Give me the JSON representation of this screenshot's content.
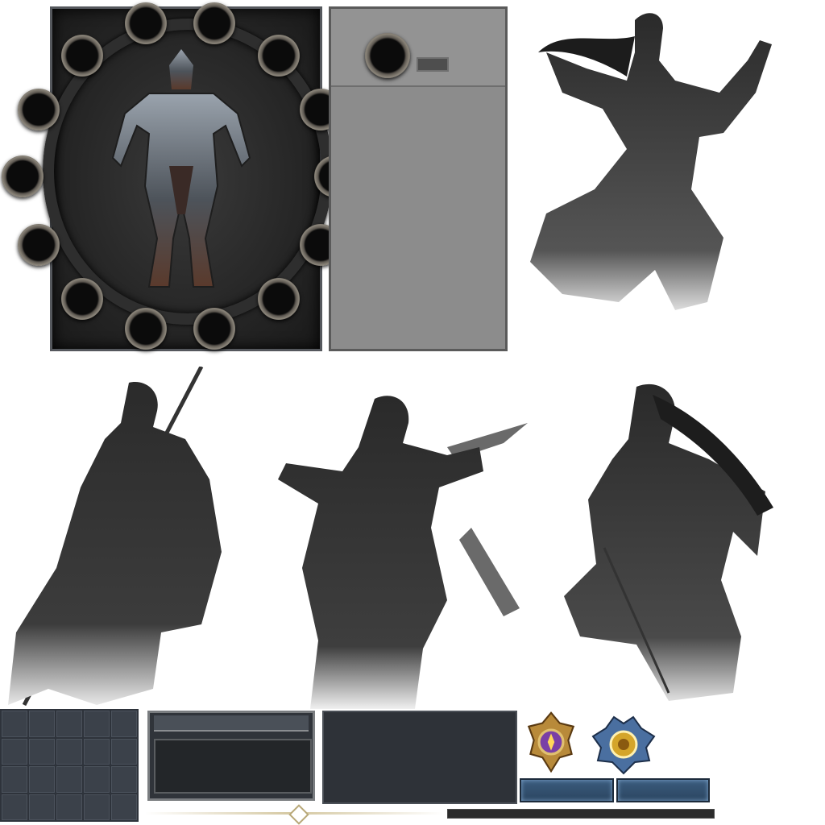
{
  "equipment": {
    "slot_count": 14,
    "slot_icon": "empty-gear-slot-icon",
    "figure_icon": "armored-knight-silhouette-icon"
  },
  "detail_panel": {
    "slot_icon": "empty-gear-slot-icon"
  },
  "characters": [
    {
      "icon": "female-swordswoman-portrait"
    },
    {
      "icon": "male-spearman-portrait"
    },
    {
      "icon": "male-blade-warrior-portrait"
    },
    {
      "icon": "female-archer-portrait"
    }
  ],
  "inventory_grid": {
    "rows": 4,
    "cols": 5
  },
  "badges": [
    {
      "icon": "purple-crest-badge-icon",
      "accent": "#7a3fa6"
    },
    {
      "icon": "gold-crest-badge-icon",
      "accent": "#d4a52a"
    }
  ],
  "colors": {
    "panel_dark": "#262626",
    "slot_rim": "#8b857a",
    "tab_blue": "#3b5c7e",
    "divider_gold": "#d4c7a0"
  }
}
